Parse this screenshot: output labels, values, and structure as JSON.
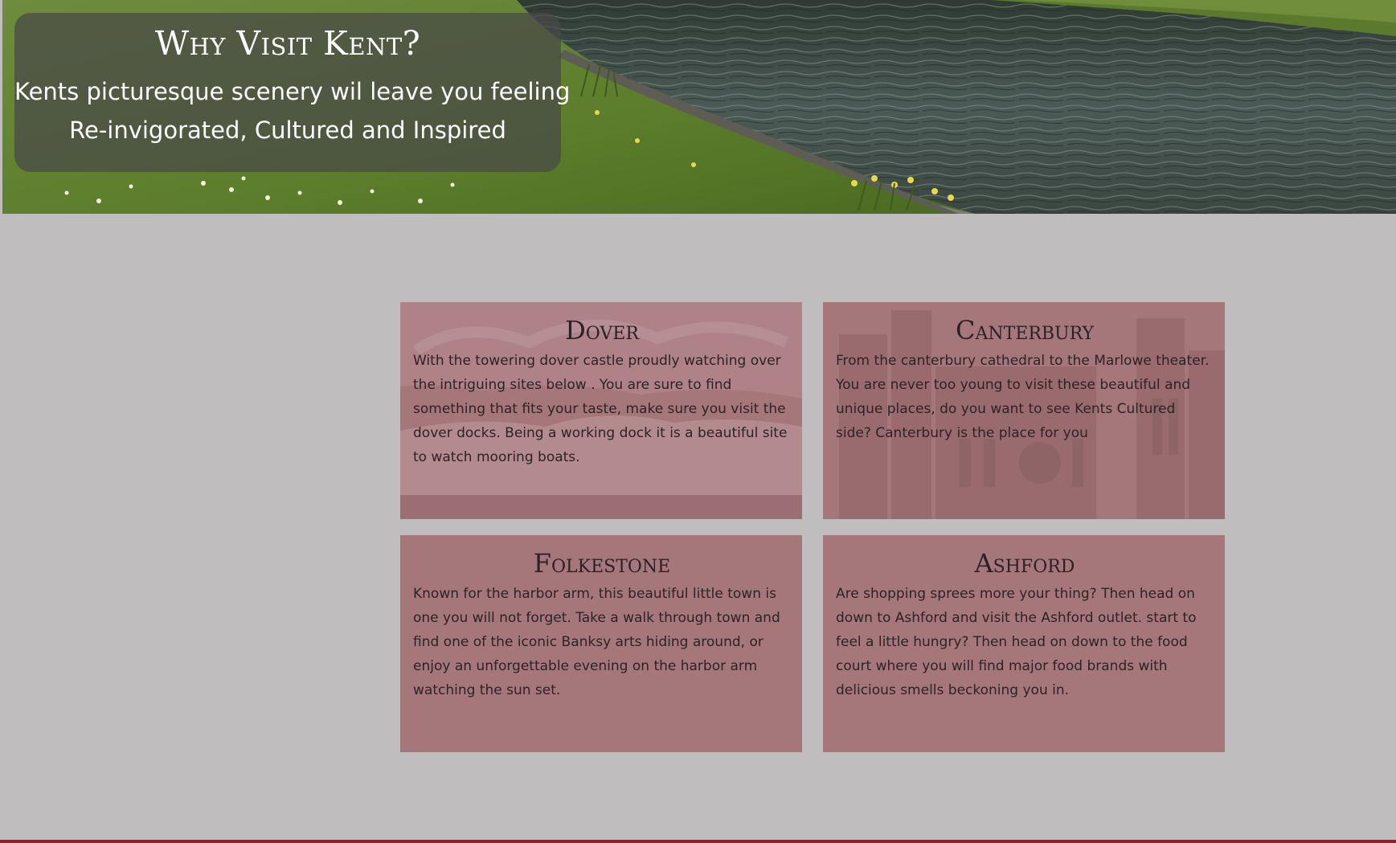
{
  "hero": {
    "title": "Why Visit Kent?",
    "line1": "Kents picturesque scenery wil leave you feeling",
    "line2": "Re-invigorated, Cultured and Inspired"
  },
  "cards": [
    {
      "title": "Dover",
      "text": "With the towering dover castle proudly watching over the intriguing sites below . You are sure to find something that fits your taste, make sure you visit the dover docks. Being a working dock it is a beautiful site to watch mooring boats."
    },
    {
      "title": "Canterbury",
      "text": "From the canterbury cathedral to the Marlowe theater. You are never too young to visit these beautiful and unique places, do you want to see Kents Cultured side? Canterbury is the place for you"
    },
    {
      "title": "Folkestone",
      "text": "Known for the harbor arm, this beautiful little town is one you will not forget. Take a walk through town and find one of the iconic Banksy arts hiding around, or enjoy an unforgettable evening on the harbor arm watching the sun set."
    },
    {
      "title": "Ashford",
      "text": "Are shopping sprees more your thing? Then head on down to Ashford and visit the Ashford outlet. start to feel a little hungry? Then head on down to the food court where you will find major food brands with delicious smells beckoning you in."
    }
  ],
  "colors": {
    "page_background": "#c0bdbe",
    "card_background": "#a6777a",
    "footer_line": "#9b1c22"
  }
}
